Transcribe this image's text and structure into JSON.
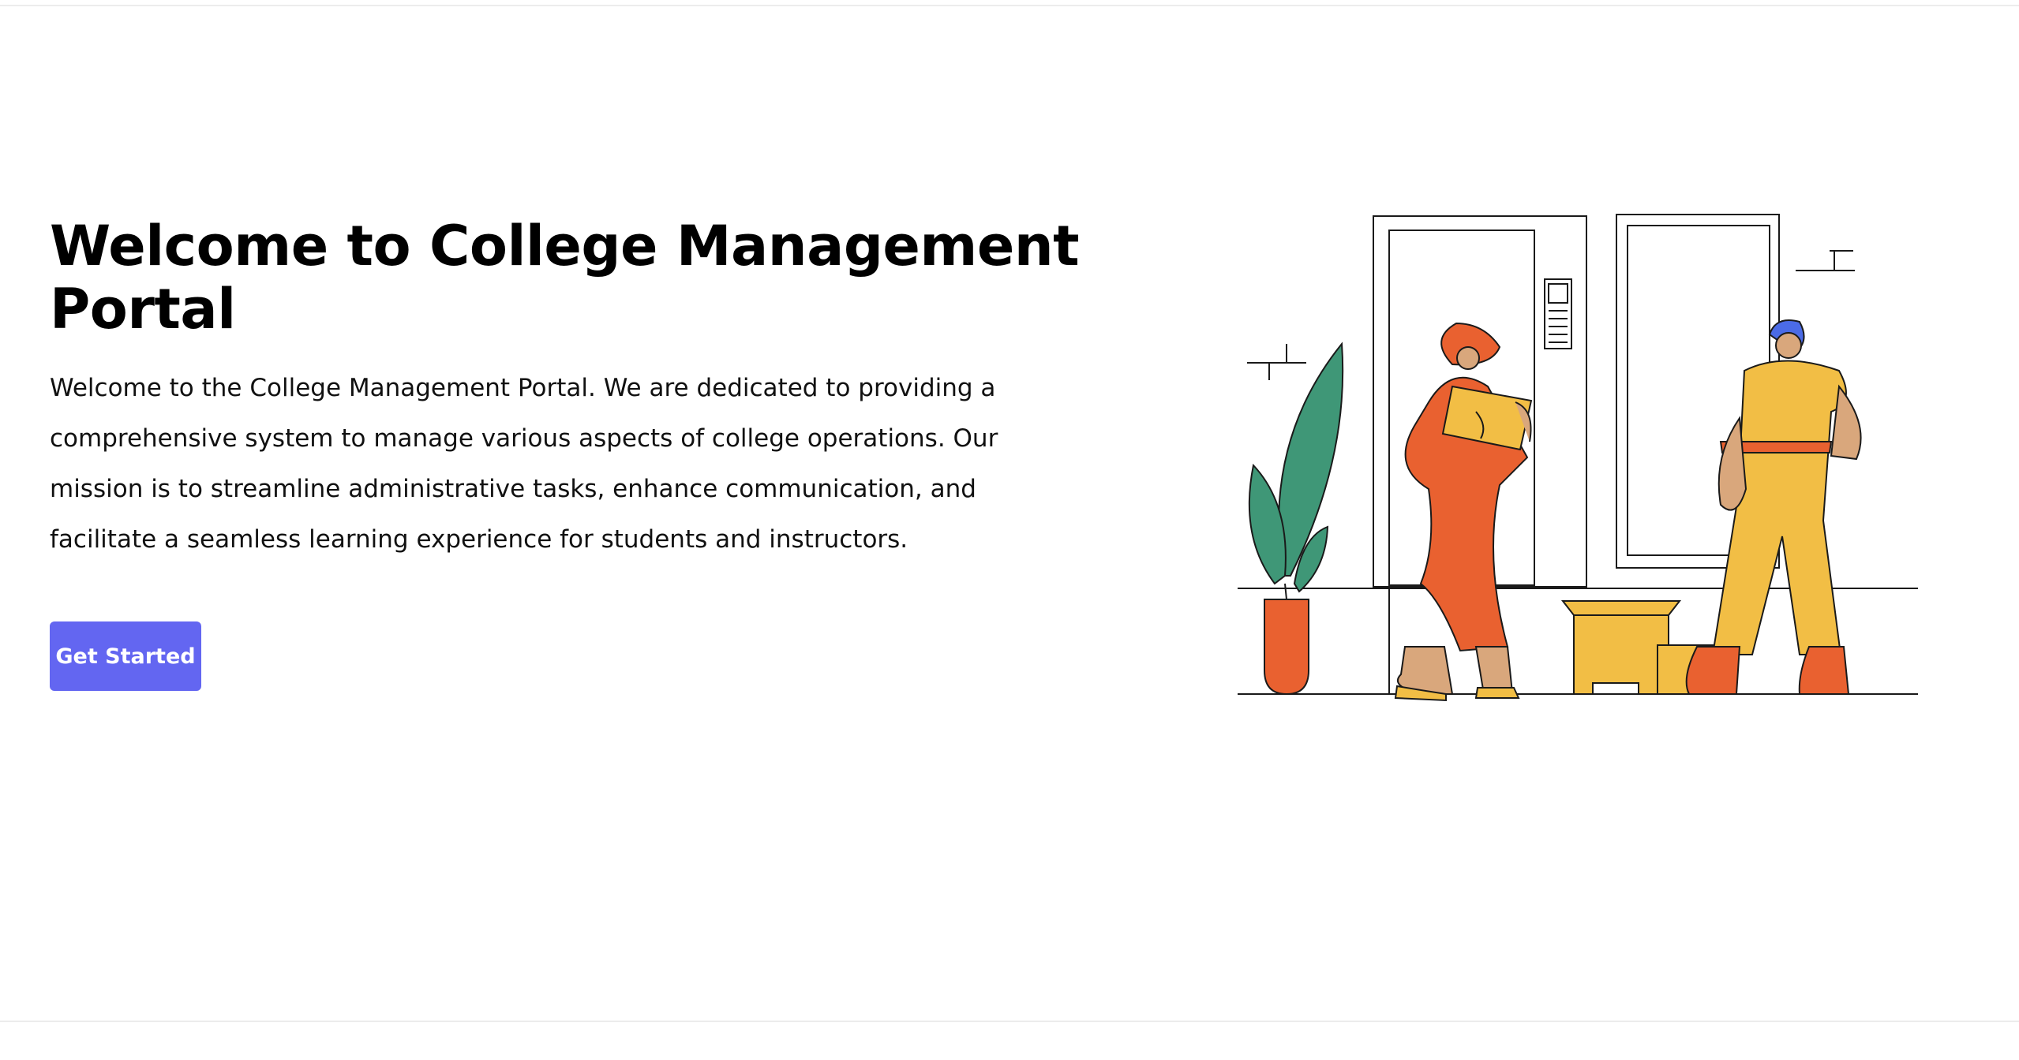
{
  "hero": {
    "title": "Welcome to College Management Portal",
    "description": "Welcome to the College Management Portal. We are dedicated to providing a comprehensive system to manage various aspects of college operations. Our mission is to streamline administrative tasks, enhance communication, and facilitate a seamless learning experience for students and instructors.",
    "cta_label": "Get Started"
  },
  "colors": {
    "accent": "#6366f1",
    "orange": "#e96130",
    "yellow": "#f2be45",
    "green": "#3f9777",
    "blue": "#4b6be6",
    "skin": "#d9a77c"
  },
  "illustration": {
    "icon": "moving-people-illustration"
  }
}
